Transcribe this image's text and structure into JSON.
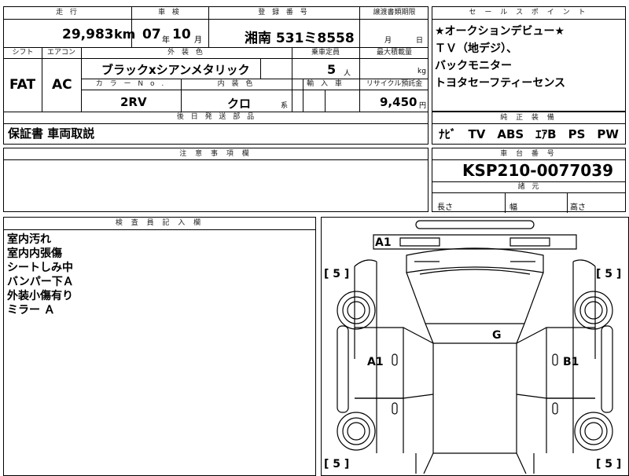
{
  "spec": {
    "headers": {
      "mileage": "走 行",
      "inspection": "車 検",
      "registration": "登 録 番 号",
      "transfer_deadline": "譲渡書類期限",
      "shift": "シフト",
      "aircon": "エアコン",
      "exterior_color": "外 装 色",
      "capacity": "乗車定員",
      "max_load": "最大積載量",
      "color_no": "カ ラ ー N o .",
      "interior_color": "内 装 色",
      "import": "輸 入 車",
      "recycle": "リサイクル預託金",
      "later_parts": "後 日 発 送 部 品"
    },
    "mileage": "29,983",
    "mileage_unit": "km",
    "inspection_year": "07",
    "year_unit": "年",
    "inspection_month": "10",
    "month_unit": "月",
    "registration_number": "湘南 531ミ8558",
    "transfer_month_unit": "月",
    "transfer_day_unit": "日",
    "shift": "FAT",
    "aircon": "AC",
    "exterior_color": "ブラックxシアンメタリック",
    "capacity": "5",
    "capacity_unit": "人",
    "max_load_unit": "kg",
    "color_no": "2RV",
    "interior_color": "クロ",
    "interior_color_suffix": "系",
    "recycle_fee": "9,450",
    "recycle_unit": "円",
    "later_parts": "保証書 車両取説"
  },
  "sales_points": {
    "header": "セ ー ル ス ポ イ ン ト",
    "lines": [
      "★オークションデビュー★",
      "ＴＶ（地デジ）、",
      "バックモニター",
      "トヨタセーフティーセンス"
    ]
  },
  "equipment": {
    "header": "純 正 装 備",
    "value": "ﾅﾋﾞ　TV　ABS　ｴｱB　PS　PW"
  },
  "notes": {
    "header": "注 意 事 項 欄"
  },
  "chassis": {
    "header": "車 台 番 号",
    "number": "KSP210-0077039",
    "dims_header": "諸 元",
    "length": "長さ",
    "width": "幅",
    "height": "高さ"
  },
  "inspector": {
    "header": "検 査 員 記 入 欄",
    "lines": [
      "室内汚れ",
      "室内内張傷",
      "シートしみ中",
      "バンパー下Ａ",
      "外装小傷有り",
      "ミラー Ａ"
    ]
  },
  "diagram": {
    "tire_fl": "[ 5 ]",
    "tire_fr": "[ 5 ]",
    "tire_rl": "[ 5 ]",
    "tire_rr": "[ 5 ]",
    "mark_front": "A1",
    "mark_left": "A1",
    "mark_right": "B1",
    "mark_glass": "G"
  }
}
